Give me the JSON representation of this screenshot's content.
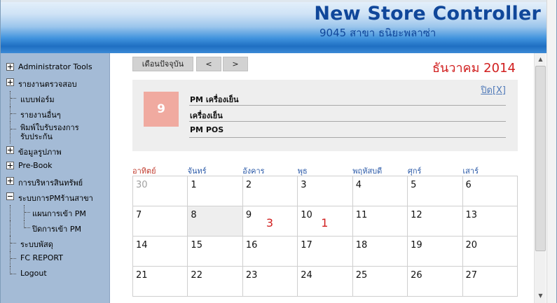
{
  "header": {
    "app_title": "New Store Controller",
    "store_name": "9045 สาขา ธนิยะพลาซ่า"
  },
  "sidebar": {
    "items": [
      {
        "label": "Administrator Tools",
        "expander": "plus"
      },
      {
        "label": "รายงานตรวจสอบ",
        "expander": "plus"
      },
      {
        "label": "แบบฟอร์ม"
      },
      {
        "label": "รายงานอื่นๆ"
      },
      {
        "label": "พิมพ์ใบรับรองการ",
        "label2": "รับประกัน"
      },
      {
        "label": "ข้อมูลรูปภาพ",
        "expander": "plus"
      },
      {
        "label": "Pre-Book",
        "expander": "plus"
      },
      {
        "label": "การบริหารสินทรัพย์",
        "expander": "plus"
      },
      {
        "label": "ระบบการPMร้านสาขา",
        "expander": "minus"
      },
      {
        "label": "แผนการเข้า PM"
      },
      {
        "label": "ปิดการเข้า PM"
      },
      {
        "label": "ระบบพัสดุ"
      },
      {
        "label": "FC REPORT"
      },
      {
        "label": "Logout"
      }
    ]
  },
  "toolbar": {
    "current_month_label": "เดือนปัจจุบัน",
    "prev_label": "<",
    "next_label": ">"
  },
  "month_title": "ธันวาคม 2014",
  "info_panel": {
    "close_label": "ปิด[X]",
    "selected_day": "9",
    "rows": [
      "PM เครื่องเย็น",
      "เครื่องเย็น",
      "PM POS"
    ]
  },
  "calendar": {
    "weekdays": [
      "อาทิตย์",
      "จันทร์",
      "อังคาร",
      "พุธ",
      "พฤหัสบดี",
      "ศุกร์",
      "เสาร์"
    ],
    "weeks": [
      [
        {
          "day": "30",
          "other": true
        },
        {
          "day": "1"
        },
        {
          "day": "2"
        },
        {
          "day": "3"
        },
        {
          "day": "4"
        },
        {
          "day": "5"
        },
        {
          "day": "6"
        }
      ],
      [
        {
          "day": "7"
        },
        {
          "day": "8",
          "today": true
        },
        {
          "day": "9",
          "count": "3"
        },
        {
          "day": "10",
          "count": "1"
        },
        {
          "day": "11"
        },
        {
          "day": "12"
        },
        {
          "day": "13"
        }
      ],
      [
        {
          "day": "14"
        },
        {
          "day": "15"
        },
        {
          "day": "16"
        },
        {
          "day": "17"
        },
        {
          "day": "18"
        },
        {
          "day": "19"
        },
        {
          "day": "20"
        }
      ],
      [
        {
          "day": "21"
        },
        {
          "day": "22"
        },
        {
          "day": "23"
        },
        {
          "day": "24"
        },
        {
          "day": "25"
        },
        {
          "day": "26"
        },
        {
          "day": "27"
        }
      ]
    ]
  },
  "colors": {
    "header_title": "#10479a",
    "month_title": "#d11f1f",
    "sidebar_bg": "#a4bbd6",
    "selected_day_bg": "#f0aaa0",
    "weekday_header": "#2b5aa8",
    "sunday_header": "#c0392b",
    "event_count": "#d11f1f"
  }
}
